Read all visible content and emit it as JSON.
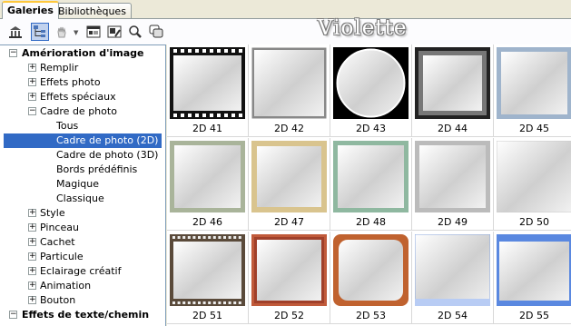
{
  "tabs": [
    {
      "label": "Galeries",
      "active": true
    },
    {
      "label": "Bibliothèques",
      "active": false
    }
  ],
  "header": {
    "title": "Violette"
  },
  "toolbar": {
    "buttons": [
      {
        "icon": "home-icon"
      },
      {
        "icon": "tree-view-icon",
        "pressed": true
      },
      {
        "icon": "hand-icon"
      },
      {
        "icon": "dropdown-caret-icon"
      },
      {
        "icon": "window-icon"
      },
      {
        "icon": "image-edit-icon"
      },
      {
        "icon": "search-icon"
      },
      {
        "icon": "copy-icon"
      }
    ]
  },
  "tree": [
    {
      "label": "Amérioration d'image",
      "level": 0,
      "expander": "−",
      "bold": true
    },
    {
      "label": "Remplir",
      "level": 1,
      "expander": "+"
    },
    {
      "label": "Effets photo",
      "level": 1,
      "expander": "+"
    },
    {
      "label": "Effets spéciaux",
      "level": 1,
      "expander": "+"
    },
    {
      "label": "Cadre de photo",
      "level": 1,
      "expander": "−"
    },
    {
      "label": "Tous",
      "level": 2
    },
    {
      "label": "Cadre de photo (2D)",
      "level": 2,
      "selected": true
    },
    {
      "label": "Cadre de photo (3D)",
      "level": 2
    },
    {
      "label": "Bords prédéfinis",
      "level": 2
    },
    {
      "label": "Magique",
      "level": 2
    },
    {
      "label": "Classique",
      "level": 2
    },
    {
      "label": "Style",
      "level": 1,
      "expander": "+"
    },
    {
      "label": "Pinceau",
      "level": 1,
      "expander": "+"
    },
    {
      "label": "Cachet",
      "level": 1,
      "expander": "+"
    },
    {
      "label": "Particule",
      "level": 1,
      "expander": "+"
    },
    {
      "label": "Eclairage créatif",
      "level": 1,
      "expander": "+"
    },
    {
      "label": "Animation",
      "level": 1,
      "expander": "+"
    },
    {
      "label": "Bouton",
      "level": 1,
      "expander": "+"
    },
    {
      "label": "Effets de texte/chemin",
      "level": 0,
      "expander": "−",
      "bold": true
    }
  ],
  "gallery": [
    {
      "label": "2D 41",
      "style": "film"
    },
    {
      "label": "2D 42",
      "style": "thin-gray"
    },
    {
      "label": "2D 43",
      "style": "circle-black"
    },
    {
      "label": "2D 44",
      "style": "thick-dark"
    },
    {
      "label": "2D 45",
      "style": "blue-texture"
    },
    {
      "label": "2D 46",
      "style": "green-texture"
    },
    {
      "label": "2D 47",
      "style": "beige"
    },
    {
      "label": "2D 48",
      "style": "green-marble"
    },
    {
      "label": "2D 49",
      "style": "light-gray"
    },
    {
      "label": "2D 50",
      "style": "plain"
    },
    {
      "label": "2D 51",
      "style": "film-brown"
    },
    {
      "label": "2D 52",
      "style": "copper"
    },
    {
      "label": "2D 53",
      "style": "ornate-orange"
    },
    {
      "label": "2D 54",
      "style": "blue-edge"
    },
    {
      "label": "2D 55",
      "style": "blue-top"
    }
  ],
  "colors": {
    "selection": "#316ac5",
    "tab_accent": "#ffc83c"
  }
}
